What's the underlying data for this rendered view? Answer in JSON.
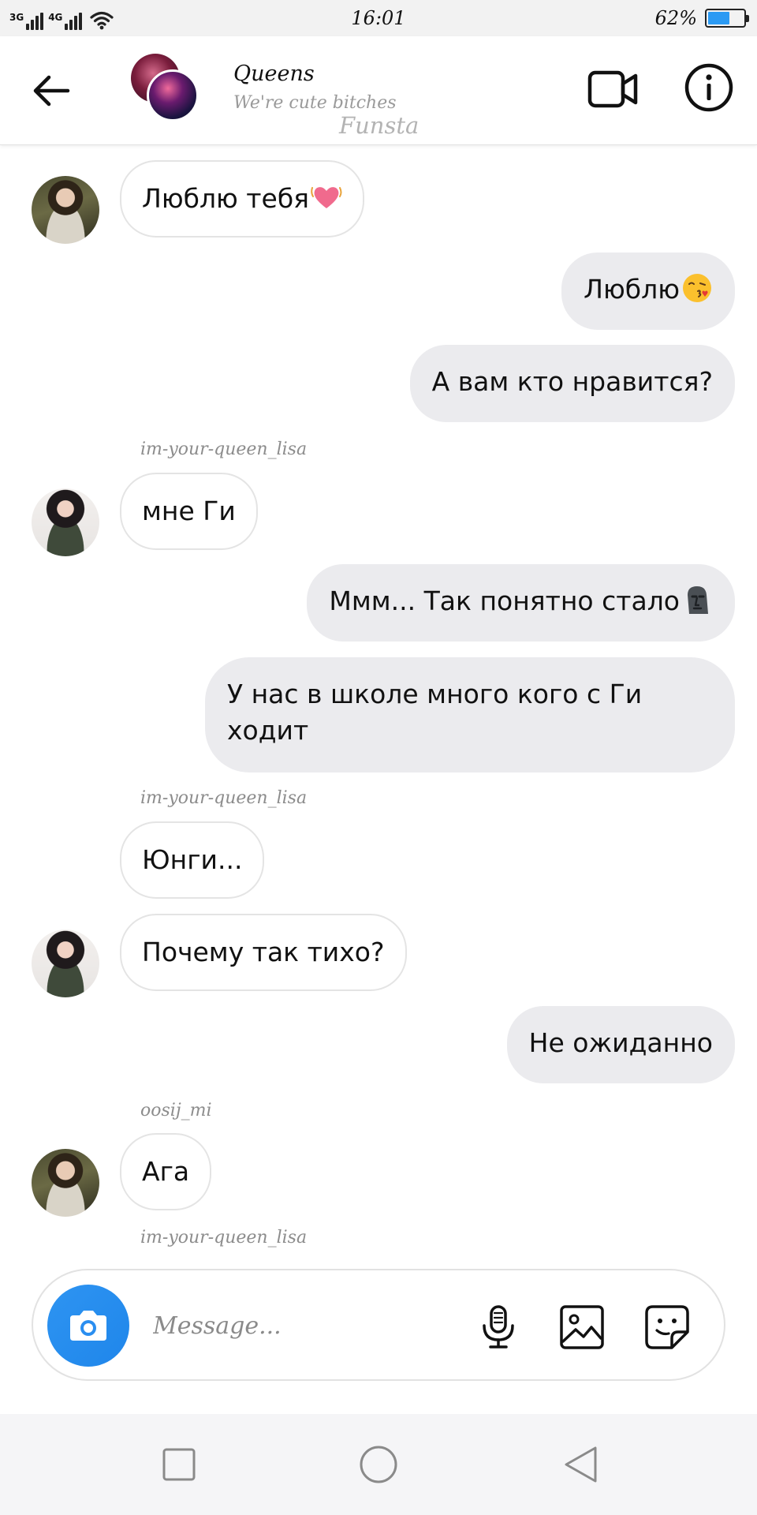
{
  "status_bar": {
    "network_1": "3G",
    "network_2": "4G",
    "time": "16:01",
    "battery_percent": "62%",
    "battery_level": 0.62,
    "battery_color": "#2b9af3"
  },
  "header": {
    "title": "Queens",
    "subtitle": "We're cute bitches",
    "watermark": "Funsta",
    "icons": [
      "arrow-back-icon",
      "video-camera-icon",
      "info-icon"
    ]
  },
  "messages": [
    {
      "id": "m1",
      "direction": "incoming",
      "text": "Люблю тебя",
      "emoji": "heart-emoji"
    },
    {
      "id": "m2",
      "direction": "outgoing",
      "text": "Люблю",
      "emoji": "kiss-face-emoji"
    },
    {
      "id": "m3",
      "direction": "outgoing",
      "text": "А вам кто нравится?"
    },
    {
      "id": "m4",
      "direction": "incoming",
      "sender": "im-your-queen_lisa",
      "text": "мне Ги"
    },
    {
      "id": "m5",
      "direction": "outgoing",
      "text": "Ммм... Так понятно стало",
      "emoji": "moai-emoji"
    },
    {
      "id": "m6",
      "direction": "outgoing",
      "text": "У нас в школе много кого с Ги ходит"
    },
    {
      "id": "m7",
      "direction": "incoming",
      "sender": "im-your-queen_lisa",
      "text": "Юнги..."
    },
    {
      "id": "m8",
      "direction": "incoming",
      "text": "Почему так тихо?"
    },
    {
      "id": "m9",
      "direction": "outgoing",
      "text": "Не ожиданно"
    },
    {
      "id": "m10",
      "direction": "incoming",
      "sender": "oosij_mi",
      "text": "Ага"
    },
    {
      "id": "m11",
      "sender": "im-your-queen_lisa"
    }
  ],
  "composer": {
    "placeholder": "Message...",
    "camera_color": "#2b8ff0",
    "icons": [
      "camera-icon",
      "microphone-icon",
      "gallery-icon",
      "sticker-icon"
    ]
  },
  "navbar": {
    "icons": [
      "recent-apps-icon",
      "home-icon",
      "back-triangle-icon"
    ]
  }
}
